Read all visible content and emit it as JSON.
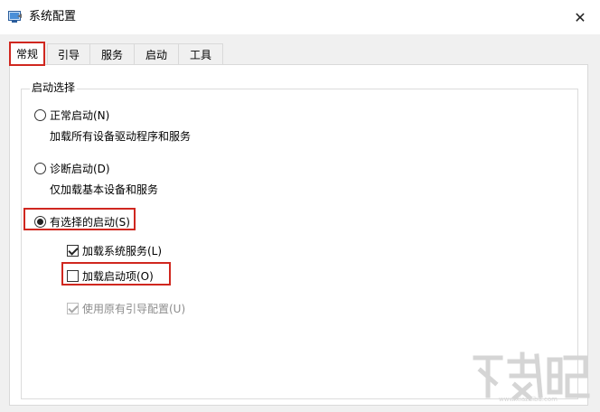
{
  "window": {
    "title": "系统配置",
    "close_glyph": "✕",
    "icon": "msconfig-icon"
  },
  "tabs": [
    {
      "label": "常规",
      "active": true
    },
    {
      "label": "引导",
      "active": false
    },
    {
      "label": "服务",
      "active": false
    },
    {
      "label": "启动",
      "active": false
    },
    {
      "label": "工具",
      "active": false
    }
  ],
  "startup_group": {
    "label": "启动选择",
    "normal": {
      "label": "正常启动(N)",
      "desc": "加载所有设备驱动程序和服务",
      "selected": false
    },
    "diagnostic": {
      "label": "诊断启动(D)",
      "desc": "仅加载基本设备和服务",
      "selected": false
    },
    "selective": {
      "label": "有选择的启动(S)",
      "selected": true
    },
    "load_services": {
      "label": "加载系统服务(L)",
      "checked": true,
      "enabled": true
    },
    "load_startup": {
      "label": "加载启动项(O)",
      "checked": false,
      "enabled": true
    },
    "use_boot_config": {
      "label": "使用原有引导配置(U)",
      "checked": true,
      "enabled": false
    }
  },
  "colors": {
    "highlight": "#d0271f",
    "panel_bg": "#f0f0f0"
  }
}
